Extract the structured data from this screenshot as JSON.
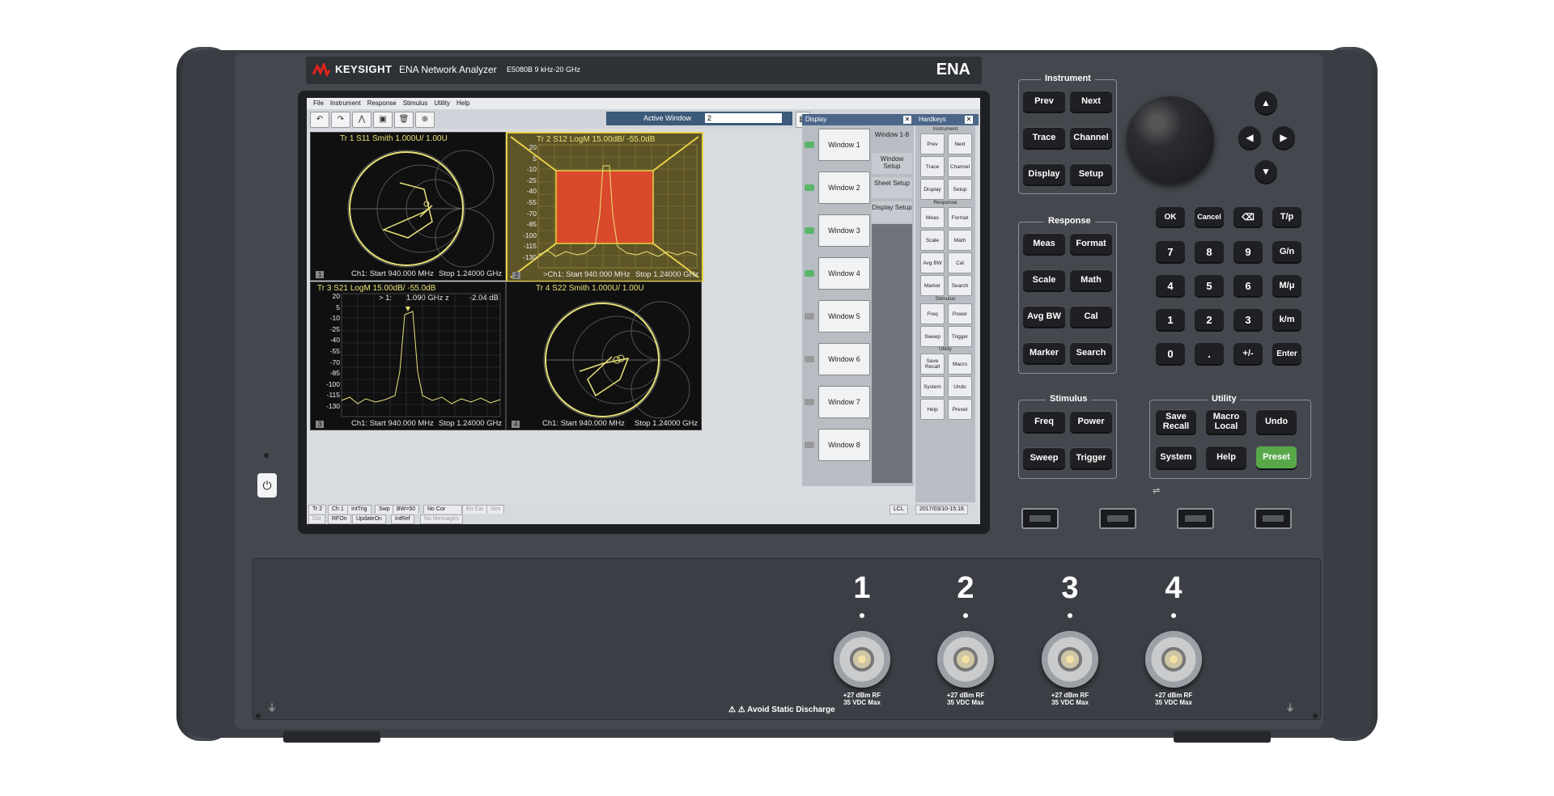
{
  "brand": {
    "company": "KEYSIGHT",
    "product": "ENA Network Analyzer",
    "model": "E5080B 9 kHz-20 GHz",
    "family": "ENA"
  },
  "menu": [
    "File",
    "Instrument",
    "Response",
    "Stimulus",
    "Utility",
    "Help"
  ],
  "toolbar": {
    "active_window_label": "Active Window",
    "active_window_value": "2"
  },
  "windows": [
    {
      "header": "Tr 1  S11 Smith 1.000U/  1.00U",
      "start": "Ch1:  Start  940.000 MHz",
      "stop": "Stop  1.24000 GHz",
      "num": "1"
    },
    {
      "header": "Tr 2  S12 LogM 15.00dB/  -55.0dB",
      "start": ">Ch1:  Start  940.000 MHz",
      "stop": "Stop  1.24000 GHz",
      "num": "2",
      "yticks": [
        "20",
        "5",
        "-10",
        "-25",
        "-40",
        "-55",
        "-70",
        "-85",
        "-100",
        "-115",
        "-130"
      ]
    },
    {
      "header": "Tr 3  S21 LogM 15.00dB/  -55.0dB",
      "start": "Ch1:  Start  940.000 MHz",
      "stop": "Stop  1.24000 GHz",
      "num": "3",
      "marker_id": "> 1:",
      "marker_freq": "1.090  GHz z",
      "marker_val": "-2.04 dB",
      "yticks": [
        "20",
        "5",
        "-10",
        "-25",
        "-40",
        "-55",
        "-70",
        "-85",
        "-100",
        "-115",
        "-130"
      ]
    },
    {
      "header": "Tr 4  S22 Smith 1.000U/  1.00U",
      "start": "Ch1:  Start  940.000 MHz",
      "stop": "Stop  1.24000 GHz",
      "num": "4"
    }
  ],
  "display_panel": {
    "title": "Display",
    "windows": [
      "Window 1",
      "Window 2",
      "Window 3",
      "Window 4",
      "Window 5",
      "Window 6",
      "Window 7",
      "Window 8"
    ],
    "side": [
      "Window 1-8",
      "Window Setup",
      "Sheet Setup",
      "Display Setup"
    ]
  },
  "hardkeys_panel": {
    "title": "Hardkeys",
    "sections": {
      "instrument": "Instrument",
      "response": "Response",
      "stimulus": "Stimulus",
      "utility": "Utility"
    },
    "keys": [
      "Prev",
      "Next",
      "Trace",
      "Channel",
      "Display",
      "Setup",
      "Meas",
      "Format",
      "Scale",
      "Math",
      "Avg BW",
      "Cal",
      "Marker",
      "Search",
      "Freq",
      "Power",
      "Sweep",
      "Trigger",
      "Save Recall",
      "Macro",
      "System",
      "Undo",
      "Help",
      "Preset"
    ]
  },
  "status": {
    "row1": [
      "Tr 2",
      "Ch 1",
      "IntTrig",
      "Swp",
      "BW=50",
      "No Cor",
      "En Cal",
      "Sim"
    ],
    "row2": [
      "Dst",
      "RFOn",
      "UpdateOn",
      "IntRef",
      "No Messages"
    ],
    "lcl": "LCL",
    "datetime": "2017/03/10-15:16"
  },
  "front_panel": {
    "instrument": {
      "label": "Instrument",
      "keys": [
        "Prev",
        "Next",
        "Trace",
        "Channel",
        "Display",
        "Setup"
      ]
    },
    "response": {
      "label": "Response",
      "keys": [
        "Meas",
        "Format",
        "Scale",
        "Math",
        "Avg BW",
        "Cal",
        "Marker",
        "Search"
      ]
    },
    "stimulus": {
      "label": "Stimulus",
      "keys": [
        "Freq",
        "Power",
        "Sweep",
        "Trigger"
      ]
    },
    "utility": {
      "label": "Utility",
      "keys": [
        "Save Recall",
        "Macro Local",
        "Undo",
        "System",
        "Help",
        "Preset"
      ]
    },
    "entry_keys": [
      "OK",
      "Cancel",
      "⌫",
      "T/p",
      "7",
      "8",
      "9",
      "G/n",
      "4",
      "5",
      "6",
      "M/μ",
      "1",
      "2",
      "3",
      "k/m",
      "0",
      ".",
      "+/-",
      "Enter"
    ]
  },
  "ports": [
    {
      "num": "1",
      "rating": "+27 dBm RF\n35 VDC Max"
    },
    {
      "num": "2",
      "rating": "+27 dBm RF\n35 VDC Max"
    },
    {
      "num": "3",
      "rating": "+27 dBm RF\n35 VDC Max"
    },
    {
      "num": "4",
      "rating": "+27 dBm RF\n35 VDC Max"
    }
  ],
  "warning": "Avoid Static Discharge",
  "colors": {
    "trace": "#e8e27a",
    "highlight": "#d94a2a",
    "preset": "#58a84a"
  }
}
